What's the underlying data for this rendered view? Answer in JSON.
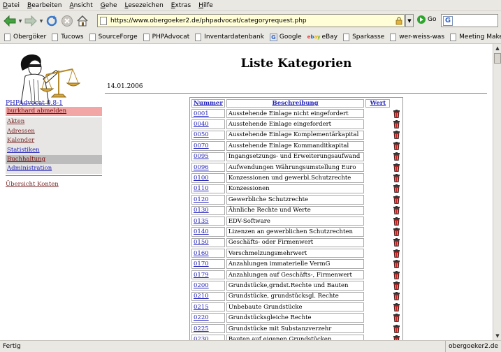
{
  "browser": {
    "menu": [
      "Datei",
      "Bearbeiten",
      "Ansicht",
      "Gehe",
      "Lesezeichen",
      "Extras",
      "Hilfe"
    ],
    "url": "https://www.obergoeker2.de/phpadvocat/categoryrequest.php",
    "go_label": "Go",
    "search_placeholder": "",
    "bookmarks": [
      {
        "label": "Obergöker",
        "icon": "page-icon"
      },
      {
        "label": "Tucows",
        "icon": "page-icon"
      },
      {
        "label": "SourceForge",
        "icon": "page-icon"
      },
      {
        "label": "PHPAdvocat",
        "icon": "page-icon"
      },
      {
        "label": "Inventardatenbank",
        "icon": "page-icon"
      },
      {
        "label": "Google",
        "icon": "google-icon"
      },
      {
        "label": "eBay",
        "icon": "ebay-icon"
      },
      {
        "label": "Sparkasse",
        "icon": "page-icon"
      },
      {
        "label": "wer-weiss-was",
        "icon": "page-icon"
      },
      {
        "label": "Meeting Maker",
        "icon": "page-icon"
      }
    ],
    "status_left": "Fertig",
    "status_right": "obergoeker2.de"
  },
  "sidebar": {
    "version": "PHPAdvocat 0.8-1",
    "logout": "burkhard abmelden",
    "items": [
      "Akten",
      "Adressen",
      "Kalender",
      "Statistiken",
      "Buchhaltung",
      "Administration"
    ],
    "active_item": "Buchhaltung",
    "accounts_link": "Übersicht Konten"
  },
  "main": {
    "title": "Liste Kategorien",
    "date": "14.01.2006",
    "columns": [
      "Nummer",
      "Beschreibung",
      "Wert"
    ],
    "rows": [
      {
        "num": "0001",
        "desc": "Ausstehende Einlage nicht eingefordert"
      },
      {
        "num": "0040",
        "desc": "Ausstehende Einlage eingefordert"
      },
      {
        "num": "0050",
        "desc": "Ausstehende Einlage Komplementärkapital"
      },
      {
        "num": "0070",
        "desc": "Ausstehende Einlage Kommanditkapital"
      },
      {
        "num": "0095",
        "desc": "Ingangsetzungs- und Erweiterungsaufwand"
      },
      {
        "num": "0096",
        "desc": "Aufwendungen Währungsumstellung Euro"
      },
      {
        "num": "0100",
        "desc": "Konzessionen und gewerbl.Schutzrechte"
      },
      {
        "num": "0110",
        "desc": "Konzessionen"
      },
      {
        "num": "0120",
        "desc": "Gewerbliche Schutzrechte"
      },
      {
        "num": "0130",
        "desc": "Ähnliche Rechte und Werte"
      },
      {
        "num": "0135",
        "desc": "EDV-Software"
      },
      {
        "num": "0140",
        "desc": "Lizenzen an gewerblichen Schutzrechten"
      },
      {
        "num": "0150",
        "desc": "Geschäfts- oder Firmenwert"
      },
      {
        "num": "0160",
        "desc": "Verschmelzungsmehrwert"
      },
      {
        "num": "0170",
        "desc": "Anzahlungen immaterielle VermG"
      },
      {
        "num": "0179",
        "desc": "Anzahlungen auf Geschäfts-, Firmenwert"
      },
      {
        "num": "0200",
        "desc": "Grundstücke,grndst.Rechte und Bauten"
      },
      {
        "num": "0210",
        "desc": "Grundstücke, grundstücksgl. Rechte"
      },
      {
        "num": "0215",
        "desc": "Unbebaute Grundstücke"
      },
      {
        "num": "0220",
        "desc": "Grundstücksgleiche Rechte"
      },
      {
        "num": "0225",
        "desc": "Grundstücke mit Substanzverzehr"
      },
      {
        "num": "0230",
        "desc": "Bauten auf eigenen Grundstücken"
      }
    ]
  }
}
